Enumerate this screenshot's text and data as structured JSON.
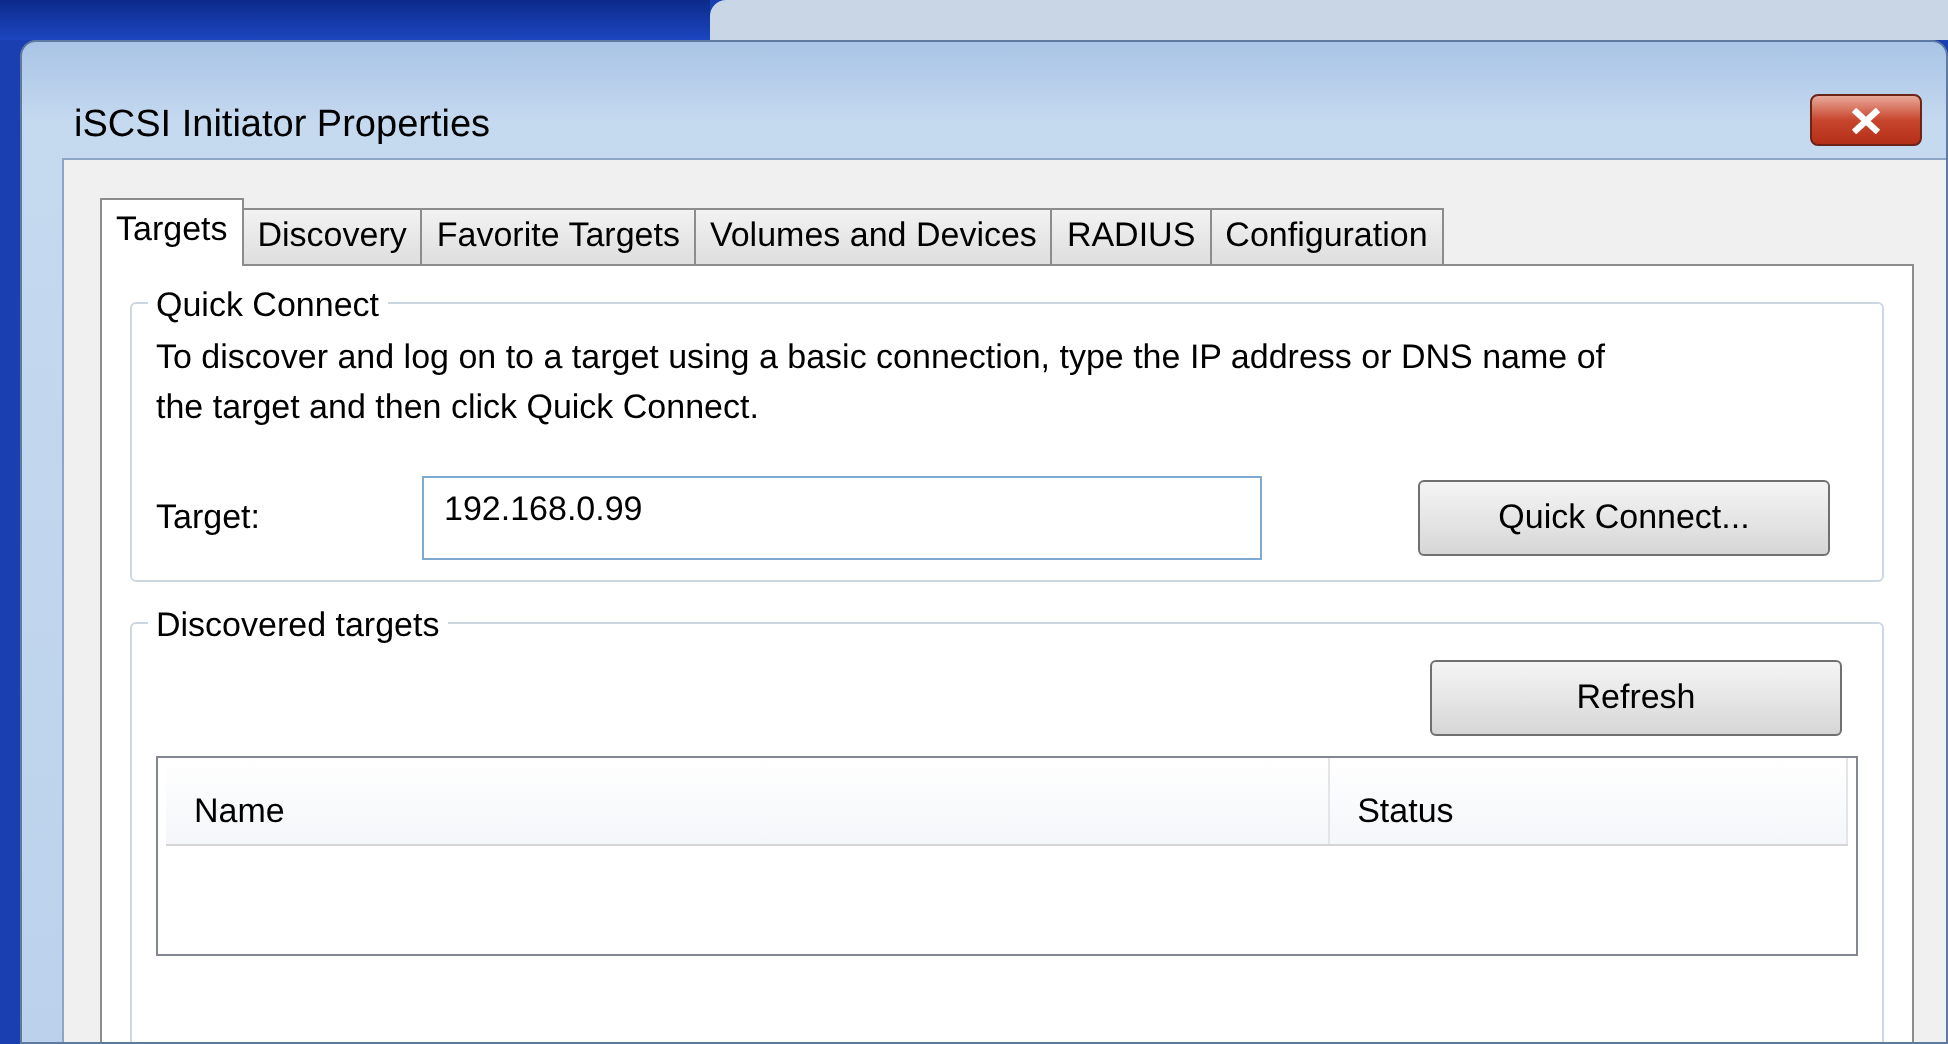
{
  "window": {
    "title": "iSCSI Initiator Properties"
  },
  "tabs": [
    {
      "label": "Targets",
      "selected": true
    },
    {
      "label": "Discovery",
      "selected": false
    },
    {
      "label": "Favorite Targets",
      "selected": false
    },
    {
      "label": "Volumes and Devices",
      "selected": false
    },
    {
      "label": "RADIUS",
      "selected": false
    },
    {
      "label": "Configuration",
      "selected": false
    }
  ],
  "quick_connect": {
    "title": "Quick Connect",
    "description": "To discover and log on to a target using a basic connection, type the IP address or DNS name of the target and then click Quick Connect.",
    "target_label": "Target:",
    "target_value": "192.168.0.99",
    "button": "Quick Connect..."
  },
  "discovered_targets": {
    "title": "Discovered targets",
    "refresh_button": "Refresh",
    "table": {
      "columns": [
        "Name",
        "Status"
      ]
    }
  }
}
